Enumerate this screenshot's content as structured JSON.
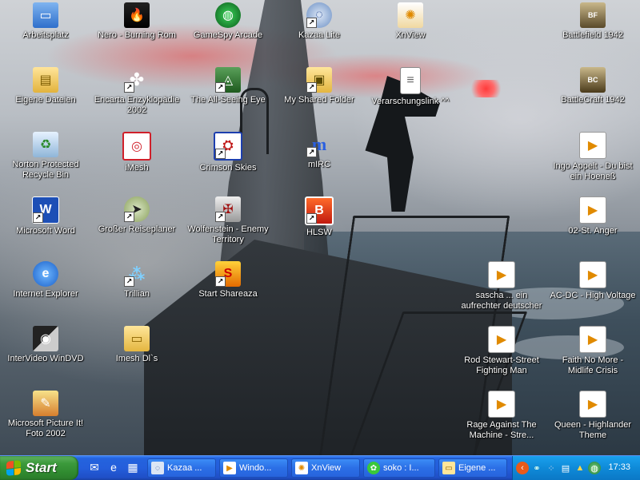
{
  "desktop": {
    "icons": [
      {
        "label": "Arbeitsplatz",
        "icon": "my-computer-icon"
      },
      {
        "label": "Nero - Burning Rom",
        "icon": "nero-icon"
      },
      {
        "label": "GameSpy Arcade",
        "icon": "gamespy-icon"
      },
      {
        "label": "Kazaa Lite",
        "icon": "kazaa-icon"
      },
      {
        "label": "XnView",
        "icon": "xnview-icon"
      },
      {
        "label": "Battlefield 1942",
        "icon": "battlefield-icon"
      },
      {
        "label": "Eigene Dateien",
        "icon": "my-documents-icon"
      },
      {
        "label": "Encarta Enzyklopädie 2002",
        "icon": "encarta-icon"
      },
      {
        "label": "The All-Seeing Eye",
        "icon": "all-seeing-eye-icon"
      },
      {
        "label": "My Shared Folder",
        "icon": "shared-folder-icon"
      },
      {
        "label": "Verarschungslink ^^",
        "icon": "document-icon"
      },
      {
        "label": "BattleCraft 1942",
        "icon": "battlecraft-icon"
      },
      {
        "label": "Norton Protected Recycle Bin",
        "icon": "recycle-bin-icon"
      },
      {
        "label": "iMesh",
        "icon": "imesh-icon"
      },
      {
        "label": "Crimson Skies",
        "icon": "crimson-skies-icon"
      },
      {
        "label": "mIRC",
        "icon": "mirc-icon"
      },
      {
        "label": "Ingo Appelt - Du bist ein Hoeneß",
        "icon": "media-file-icon"
      },
      {
        "label": "Microsoft Word",
        "icon": "word-icon"
      },
      {
        "label": "Großer Reiseplaner",
        "icon": "reiseplaner-icon"
      },
      {
        "label": "Wolfenstein - Enemy Territory",
        "icon": "wolfenstein-icon"
      },
      {
        "label": "HLSW",
        "icon": "hlsw-icon"
      },
      {
        "label": "02-St. Anger",
        "icon": "media-file-icon"
      },
      {
        "label": "Internet Explorer",
        "icon": "internet-explorer-icon"
      },
      {
        "label": "Trillian",
        "icon": "trillian-icon"
      },
      {
        "label": "Start Shareaza",
        "icon": "shareaza-icon"
      },
      {
        "label": "sascha ... ein aufrechter deutscher",
        "icon": "media-file-icon"
      },
      {
        "label": "AC-DC - High Voltage",
        "icon": "media-file-icon"
      },
      {
        "label": "InterVideo WinDVD",
        "icon": "windvd-icon"
      },
      {
        "label": "Imesh Dl`s",
        "icon": "folder-icon"
      },
      {
        "label": "Rod Stewart-Street Fighting Man",
        "icon": "media-file-icon"
      },
      {
        "label": "Faith No More - Midlife Crisis",
        "icon": "media-file-icon"
      },
      {
        "label": "Microsoft Picture It! Foto 2002",
        "icon": "picture-it-icon"
      },
      {
        "label": "Rage Against The Machine - Stre...",
        "icon": "media-file-icon"
      },
      {
        "label": "Queen - Highlander Theme",
        "icon": "media-file-icon"
      }
    ]
  },
  "taskbar": {
    "start_label": "Start",
    "quick_launch": [
      "outlook-express-icon",
      "internet-explorer-icon",
      "show-desktop-icon"
    ],
    "tasks": [
      {
        "label": "Kazaa ...",
        "icon": "kazaa-icon"
      },
      {
        "label": "Windo...",
        "icon": "media-player-icon"
      },
      {
        "label": "XnView",
        "icon": "xnview-icon"
      },
      {
        "label": "soko : I...",
        "icon": "icq-icon"
      },
      {
        "label": "Eigene ...",
        "icon": "folder-icon"
      }
    ],
    "clock": "17:33"
  },
  "colors": {
    "taskbar_blue": "#245edb",
    "start_green": "#3c9a3c",
    "tray_blue": "#0f8ad8"
  }
}
